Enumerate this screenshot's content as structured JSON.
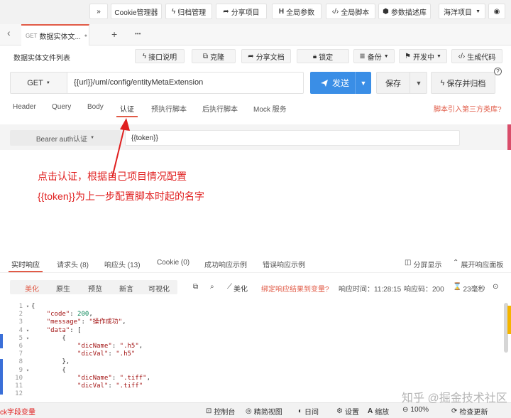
{
  "topbar": {
    "expand": "»",
    "items": [
      {
        "label": "Cookie管理器",
        "icon": ""
      },
      {
        "label": "归档管理",
        "icon": "bolt-icon"
      },
      {
        "label": "分享项目",
        "icon": "share-icon"
      },
      {
        "label": "全局参数",
        "icon": "h-icon"
      },
      {
        "label": "全局脚本",
        "icon": "code-icon"
      },
      {
        "label": "参数描述库",
        "icon": "cube-icon"
      }
    ],
    "project": "海洋项目",
    "eye": "◉"
  },
  "tabbar": {
    "back": "‹",
    "tab_method": "GET",
    "tab_title": "数据实体文...",
    "close": "●",
    "add": "+",
    "more": "•••"
  },
  "toolbar": {
    "title": "数据实体文件列表",
    "buttons": [
      {
        "label": "接口说明",
        "icon": "bolt-icon"
      },
      {
        "label": "克隆",
        "icon": "clone-icon"
      },
      {
        "label": "分享文档",
        "icon": "share-icon"
      },
      {
        "label": "锁定",
        "icon": "lock-icon"
      },
      {
        "label": "备份",
        "icon": "db-icon"
      },
      {
        "label": "开发中",
        "icon": "flag-icon"
      },
      {
        "label": "生成代码",
        "icon": "code-icon"
      }
    ]
  },
  "request": {
    "method": "GET",
    "url": "{{url}}/uml/config/entityMetaExtension",
    "send": "发送",
    "save": "保存",
    "save_archive": "保存并归档",
    "help": "?",
    "tabs": [
      "Header",
      "Query",
      "Body",
      "认证",
      "预执行脚本",
      "后执行脚本",
      "Mock 服务"
    ],
    "script_link": "脚本引入第三方类库?"
  },
  "auth": {
    "type": "Bearer auth认证",
    "token": "{{token}}"
  },
  "annotation": {
    "line1": "点击认证，根据自己项目情况配置",
    "line2": "{{token}}为上一步配置脚本时起的名字"
  },
  "response": {
    "tabs": [
      "实时响应",
      "请求头 (8)",
      "响应头 (13)",
      "Cookie (0)",
      "成功响应示例",
      "错误响应示例"
    ],
    "split": "分屏显示",
    "expand": "展开响应面板",
    "formats": [
      "美化",
      "原生",
      "预览",
      "新言",
      "可视化"
    ],
    "beautify": "美化",
    "bind": "绑定响应结果到变量?",
    "time": "响应时间：11:28:15",
    "code": "响应码：200",
    "duration": "23毫秒"
  },
  "code_lines": [
    {
      "n": "1",
      "fold": "▾",
      "text": "{"
    },
    {
      "n": "2",
      "fold": "",
      "text": "    \"code\": 200,"
    },
    {
      "n": "3",
      "fold": "",
      "text": "    \"message\": \"操作成功\","
    },
    {
      "n": "4",
      "fold": "▾",
      "text": "    \"data\": ["
    },
    {
      "n": "5",
      "fold": "▾",
      "text": "        {"
    },
    {
      "n": "6",
      "fold": "",
      "text": "            \"dicName\": \".h5\","
    },
    {
      "n": "7",
      "fold": "",
      "text": "            \"dicVal\": \".h5\""
    },
    {
      "n": "8",
      "fold": "",
      "text": "        },"
    },
    {
      "n": "9",
      "fold": "▾",
      "text": "        {"
    },
    {
      "n": "10",
      "fold": "",
      "text": "            \"dicName\": \".tiff\","
    },
    {
      "n": "11",
      "fold": "",
      "text": "            \"dicVal\": \".tiff\""
    },
    {
      "n": "12",
      "fold": "",
      "text": ""
    }
  ],
  "statusbar": {
    "left": "ck字段变量",
    "items": [
      {
        "label": "控制台",
        "icon": "console-icon"
      },
      {
        "label": "精简视图",
        "icon": "view-icon"
      },
      {
        "label": "日间",
        "icon": "day-icon"
      },
      {
        "label": "设置",
        "icon": "gear-icon"
      },
      {
        "label": "缩放",
        "icon": "font-icon"
      },
      {
        "label": "100%",
        "icon": "zoom-icon"
      },
      {
        "label": "检查更新",
        "icon": "update-icon"
      }
    ],
    "watermark": "知乎 @掘金技术社区"
  },
  "colors": {
    "accent": "#e15b47",
    "primary": "#3a8ee6",
    "annotation": "#e02020"
  }
}
